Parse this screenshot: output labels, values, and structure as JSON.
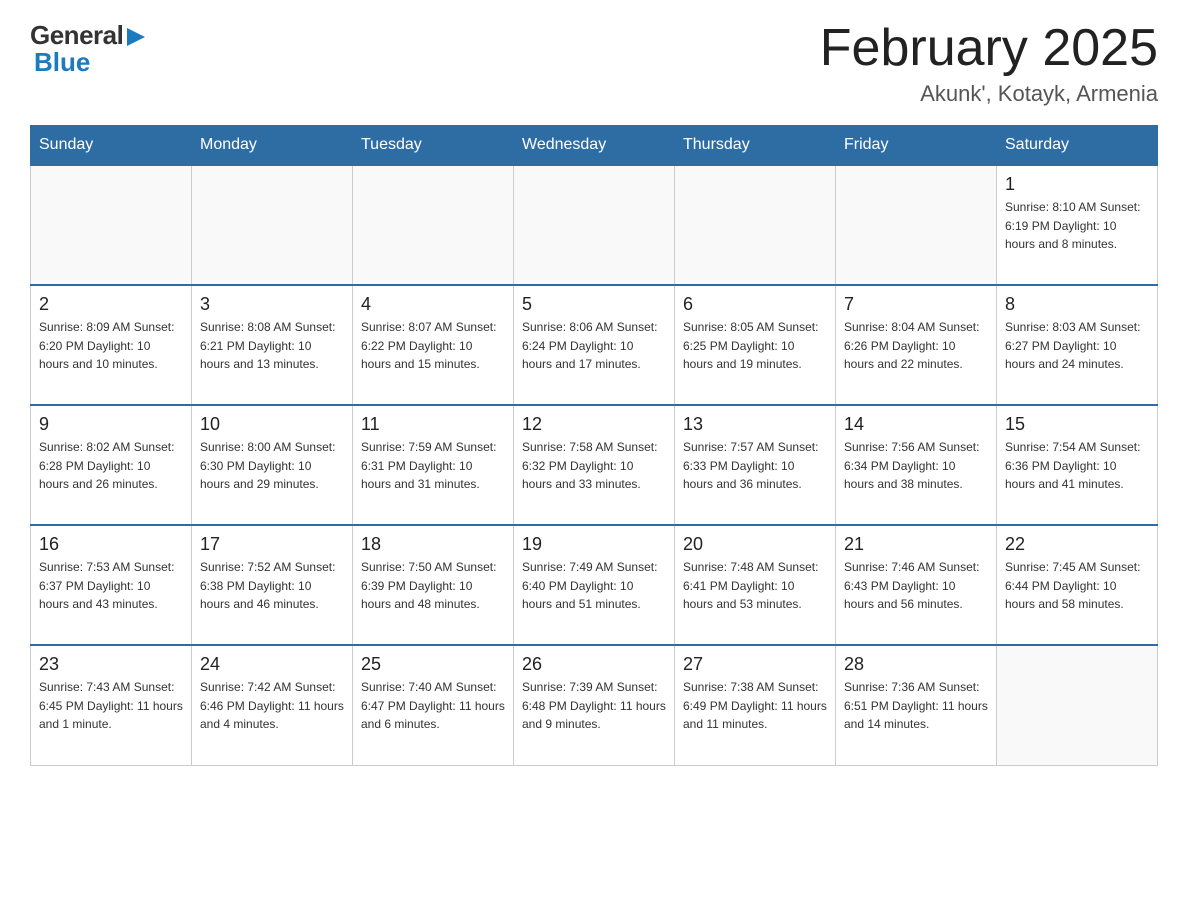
{
  "header": {
    "logo_general": "General",
    "logo_blue": "Blue",
    "title": "February 2025",
    "subtitle": "Akunk', Kotayk, Armenia"
  },
  "days_of_week": [
    "Sunday",
    "Monday",
    "Tuesday",
    "Wednesday",
    "Thursday",
    "Friday",
    "Saturday"
  ],
  "weeks": [
    [
      {
        "day": "",
        "info": ""
      },
      {
        "day": "",
        "info": ""
      },
      {
        "day": "",
        "info": ""
      },
      {
        "day": "",
        "info": ""
      },
      {
        "day": "",
        "info": ""
      },
      {
        "day": "",
        "info": ""
      },
      {
        "day": "1",
        "info": "Sunrise: 8:10 AM\nSunset: 6:19 PM\nDaylight: 10 hours and 8 minutes."
      }
    ],
    [
      {
        "day": "2",
        "info": "Sunrise: 8:09 AM\nSunset: 6:20 PM\nDaylight: 10 hours and 10 minutes."
      },
      {
        "day": "3",
        "info": "Sunrise: 8:08 AM\nSunset: 6:21 PM\nDaylight: 10 hours and 13 minutes."
      },
      {
        "day": "4",
        "info": "Sunrise: 8:07 AM\nSunset: 6:22 PM\nDaylight: 10 hours and 15 minutes."
      },
      {
        "day": "5",
        "info": "Sunrise: 8:06 AM\nSunset: 6:24 PM\nDaylight: 10 hours and 17 minutes."
      },
      {
        "day": "6",
        "info": "Sunrise: 8:05 AM\nSunset: 6:25 PM\nDaylight: 10 hours and 19 minutes."
      },
      {
        "day": "7",
        "info": "Sunrise: 8:04 AM\nSunset: 6:26 PM\nDaylight: 10 hours and 22 minutes."
      },
      {
        "day": "8",
        "info": "Sunrise: 8:03 AM\nSunset: 6:27 PM\nDaylight: 10 hours and 24 minutes."
      }
    ],
    [
      {
        "day": "9",
        "info": "Sunrise: 8:02 AM\nSunset: 6:28 PM\nDaylight: 10 hours and 26 minutes."
      },
      {
        "day": "10",
        "info": "Sunrise: 8:00 AM\nSunset: 6:30 PM\nDaylight: 10 hours and 29 minutes."
      },
      {
        "day": "11",
        "info": "Sunrise: 7:59 AM\nSunset: 6:31 PM\nDaylight: 10 hours and 31 minutes."
      },
      {
        "day": "12",
        "info": "Sunrise: 7:58 AM\nSunset: 6:32 PM\nDaylight: 10 hours and 33 minutes."
      },
      {
        "day": "13",
        "info": "Sunrise: 7:57 AM\nSunset: 6:33 PM\nDaylight: 10 hours and 36 minutes."
      },
      {
        "day": "14",
        "info": "Sunrise: 7:56 AM\nSunset: 6:34 PM\nDaylight: 10 hours and 38 minutes."
      },
      {
        "day": "15",
        "info": "Sunrise: 7:54 AM\nSunset: 6:36 PM\nDaylight: 10 hours and 41 minutes."
      }
    ],
    [
      {
        "day": "16",
        "info": "Sunrise: 7:53 AM\nSunset: 6:37 PM\nDaylight: 10 hours and 43 minutes."
      },
      {
        "day": "17",
        "info": "Sunrise: 7:52 AM\nSunset: 6:38 PM\nDaylight: 10 hours and 46 minutes."
      },
      {
        "day": "18",
        "info": "Sunrise: 7:50 AM\nSunset: 6:39 PM\nDaylight: 10 hours and 48 minutes."
      },
      {
        "day": "19",
        "info": "Sunrise: 7:49 AM\nSunset: 6:40 PM\nDaylight: 10 hours and 51 minutes."
      },
      {
        "day": "20",
        "info": "Sunrise: 7:48 AM\nSunset: 6:41 PM\nDaylight: 10 hours and 53 minutes."
      },
      {
        "day": "21",
        "info": "Sunrise: 7:46 AM\nSunset: 6:43 PM\nDaylight: 10 hours and 56 minutes."
      },
      {
        "day": "22",
        "info": "Sunrise: 7:45 AM\nSunset: 6:44 PM\nDaylight: 10 hours and 58 minutes."
      }
    ],
    [
      {
        "day": "23",
        "info": "Sunrise: 7:43 AM\nSunset: 6:45 PM\nDaylight: 11 hours and 1 minute."
      },
      {
        "day": "24",
        "info": "Sunrise: 7:42 AM\nSunset: 6:46 PM\nDaylight: 11 hours and 4 minutes."
      },
      {
        "day": "25",
        "info": "Sunrise: 7:40 AM\nSunset: 6:47 PM\nDaylight: 11 hours and 6 minutes."
      },
      {
        "day": "26",
        "info": "Sunrise: 7:39 AM\nSunset: 6:48 PM\nDaylight: 11 hours and 9 minutes."
      },
      {
        "day": "27",
        "info": "Sunrise: 7:38 AM\nSunset: 6:49 PM\nDaylight: 11 hours and 11 minutes."
      },
      {
        "day": "28",
        "info": "Sunrise: 7:36 AM\nSunset: 6:51 PM\nDaylight: 11 hours and 14 minutes."
      },
      {
        "day": "",
        "info": ""
      }
    ]
  ]
}
